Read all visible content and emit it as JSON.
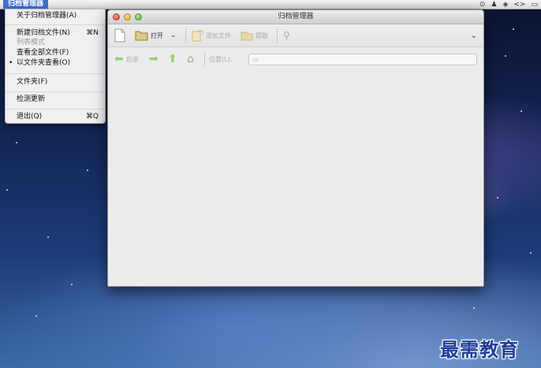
{
  "menubar": {
    "app_name": "归档管理器",
    "status": {
      "clock_like": "⊙",
      "arrows": "<>",
      "battery": "▭"
    }
  },
  "app_menu": {
    "items": [
      {
        "label": "关于归档管理器(A)",
        "shortcut": ""
      },
      {
        "label": "新建归档文件(N)",
        "shortcut": "⌘N"
      },
      {
        "label": "列表模式",
        "shortcut": "",
        "disabled": true
      },
      {
        "label": "查看全部文件(F)",
        "shortcut": ""
      },
      {
        "label": "以文件夹查看(O)",
        "shortcut": "",
        "checked": true
      },
      {
        "label": "文件夹(F)",
        "shortcut": ""
      },
      {
        "label": "检测更新",
        "shortcut": ""
      },
      {
        "label": "退出(Q)",
        "shortcut": "⌘Q"
      }
    ]
  },
  "window": {
    "title": "归档管理器",
    "toolbar": {
      "open_label": "打开",
      "add_files_label": "添加文件",
      "extract_label": "提取"
    },
    "location": {
      "back_label": "后退",
      "location_label": "位置(L):",
      "location_value": ""
    }
  },
  "watermark": "最需教育"
}
